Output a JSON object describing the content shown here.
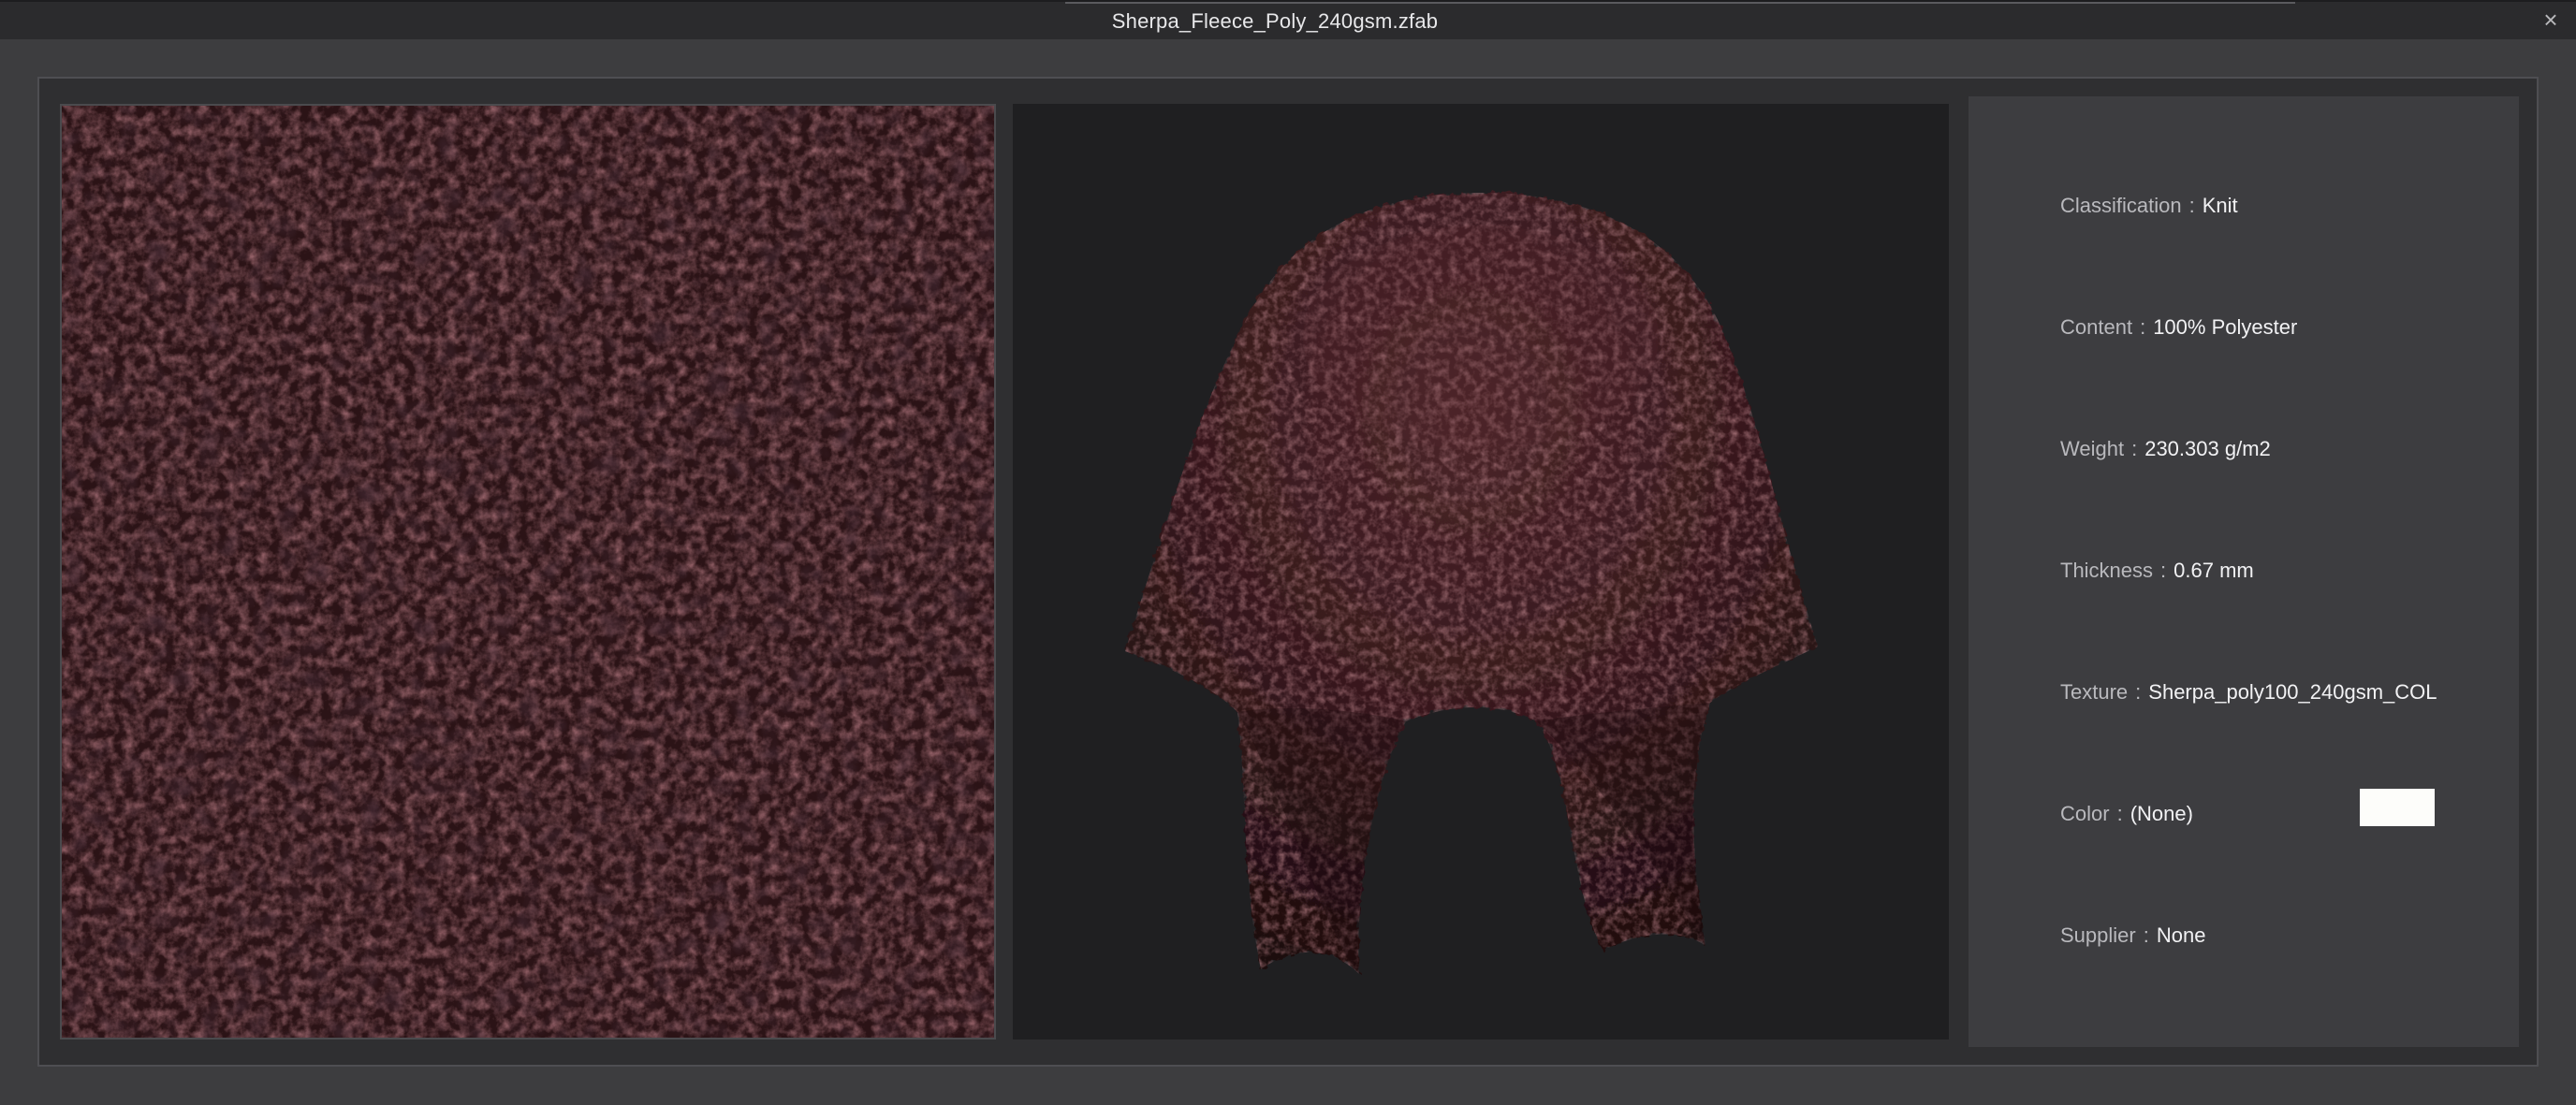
{
  "window": {
    "title": "Sherpa_Fleece_Poly_240gsm.zfab",
    "close_glyph": "×"
  },
  "swatch": {
    "base_color": "#2b1316",
    "highlight_color": "#4a2226"
  },
  "preview": {
    "background": "#1f1f21",
    "fabric_color": "#3b1a1e"
  },
  "info": {
    "rows": [
      {
        "label": "Classification",
        "value": "Knit"
      },
      {
        "label": "Content",
        "value": "100% Polyester"
      },
      {
        "label": "Weight",
        "value": "230.303 g/m2"
      },
      {
        "label": "Thickness",
        "value": "0.67 mm"
      },
      {
        "label": "Texture",
        "value": "Sherpa_poly100_240gsm_COL"
      },
      {
        "label": "Color",
        "value": "(None)"
      },
      {
        "label": "Supplier",
        "value": "None"
      }
    ],
    "separator": ":",
    "color_chip": "#fdfdfa"
  }
}
